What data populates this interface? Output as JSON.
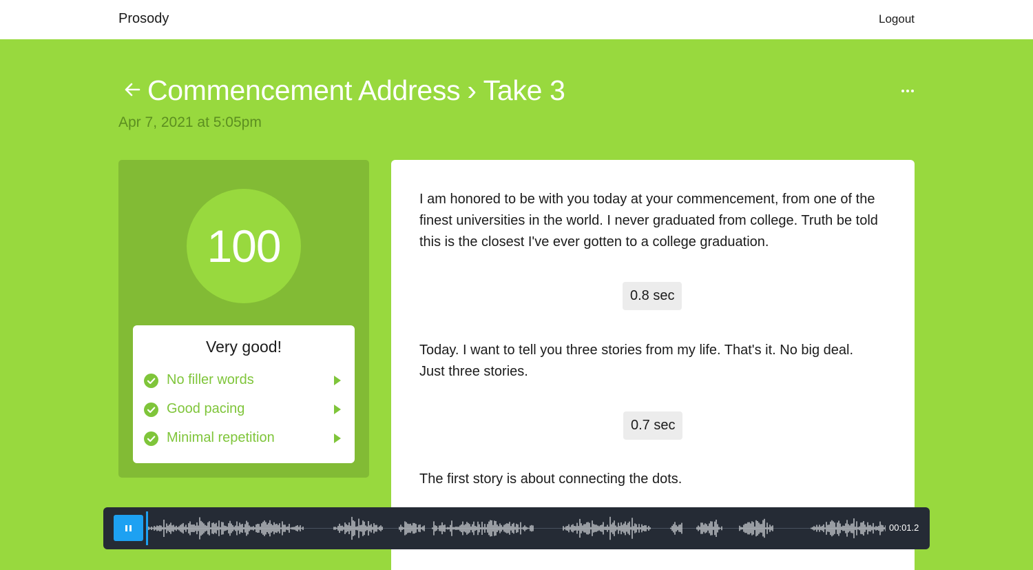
{
  "app": {
    "brand": "Prosody",
    "logout_label": "Logout"
  },
  "header": {
    "project": "Commencement Address",
    "separator": "›",
    "take": "Take 3",
    "date": "Apr 7, 2021 at 5:05pm",
    "back_icon": "arrow-left-icon",
    "more_icon": "ellipsis-icon"
  },
  "score": {
    "value": "100",
    "verdict": "Very good!",
    "items": [
      {
        "label": "No filler words",
        "icon": "check-circle-icon"
      },
      {
        "label": "Good pacing",
        "icon": "check-circle-icon"
      },
      {
        "label": "Minimal repetition",
        "icon": "check-circle-icon"
      }
    ]
  },
  "transcript": {
    "segments": [
      "I am honored to be with you today at your commencement, from one of the finest universities in the world. I never graduated from college. Truth be told this is the closest I've ever gotten to a college graduation.",
      "Today. I want to tell you three stories from my life. That's it. No big deal. Just three stories.",
      "The first story is about connecting the dots."
    ],
    "pauses": [
      "0.8 sec",
      "0.7 sec"
    ]
  },
  "player": {
    "time": "00:01.2",
    "state": "playing",
    "control_icon": "pause-icon"
  },
  "colors": {
    "background": "#98d93e",
    "panel": "#82bb35",
    "accent": "#7fc53a",
    "player": "#252b35",
    "button": "#1da1f2"
  }
}
